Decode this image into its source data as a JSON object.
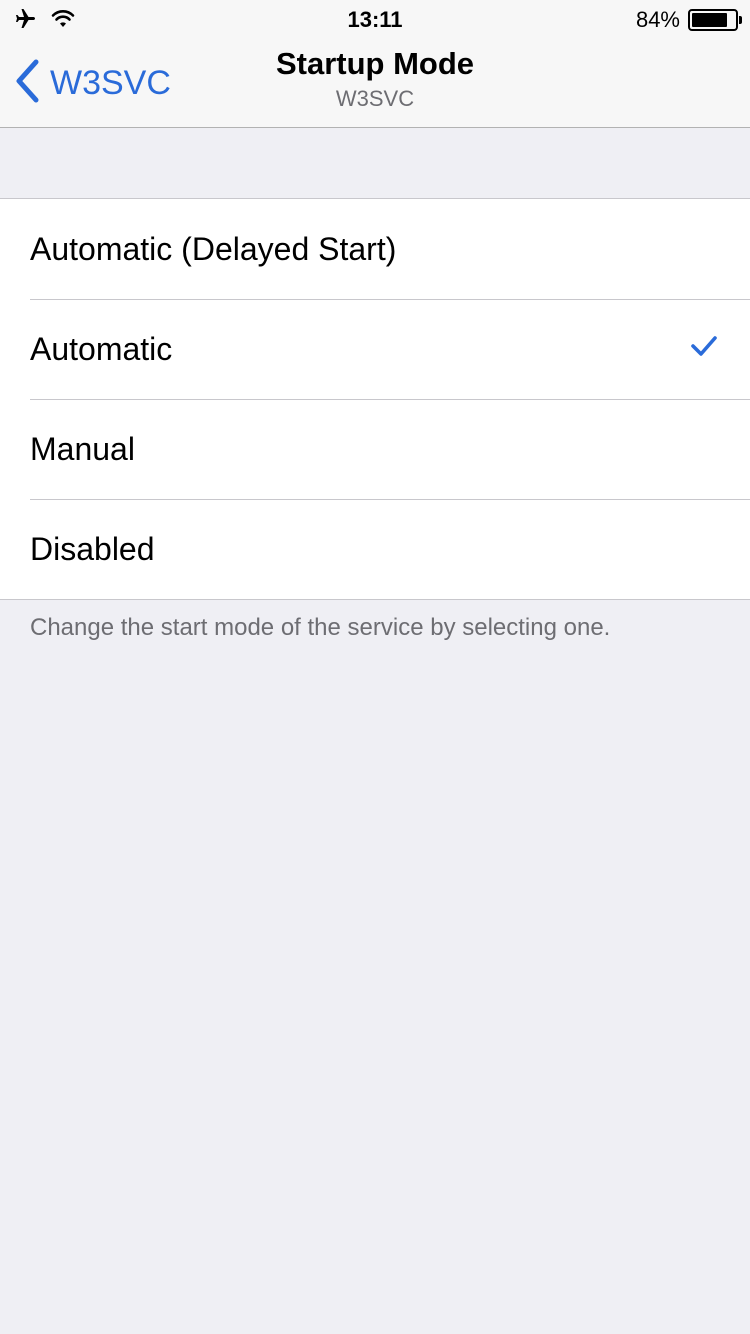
{
  "status_bar": {
    "airplane_icon": "airplane-icon",
    "wifi_icon": "wifi-icon",
    "time": "13:11",
    "battery_percent": "84%",
    "battery_level": 0.84
  },
  "nav": {
    "back_label": "W3SVC",
    "title": "Startup Mode",
    "subtitle": "W3SVC"
  },
  "options": [
    {
      "label": "Automatic (Delayed Start)",
      "selected": false
    },
    {
      "label": "Automatic",
      "selected": true
    },
    {
      "label": "Manual",
      "selected": false
    },
    {
      "label": "Disabled",
      "selected": false
    }
  ],
  "footer_text": "Change the start mode of the service by selecting one.",
  "colors": {
    "accent": "#2a6bd9",
    "background": "#efeff4",
    "separator": "#c8c7cc",
    "secondary_text": "#6d6d72"
  }
}
